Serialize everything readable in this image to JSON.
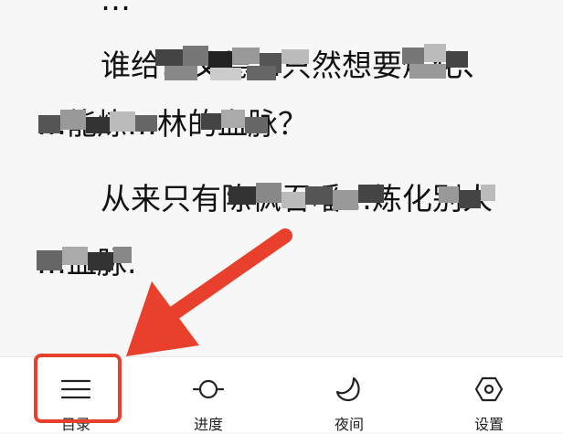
{
  "reader": {
    "lines": [
      "…",
      "谁给…父德…只然想要炼化、",
      "…能炼…林的血脉？",
      "从来只有陈枫吞噃…炼化别人",
      "…血脉."
    ]
  },
  "toolbar": {
    "toc_label": "目录",
    "progress_label": "进度",
    "night_label": "夜间",
    "settings_label": "设置"
  },
  "icons": {
    "toc": "menu-icon",
    "progress": "progress-slider-icon",
    "night": "moon-icon",
    "settings": "hexagon-gear-icon"
  },
  "colors": {
    "annotation": "#e8402c",
    "icon": "#222222",
    "text": "#111111",
    "background": "#f7f7f7"
  }
}
